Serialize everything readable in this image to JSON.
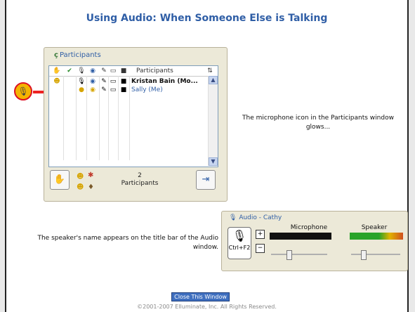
{
  "page_title": "Using Audio: When Someone Else is Talking",
  "participants_panel": {
    "title": "Participants",
    "header_label": "Participants",
    "rows": [
      {
        "name": "Kristan Bain (Mo..."
      },
      {
        "name": "Sally (Me)"
      }
    ],
    "count": "2",
    "count_label": "Participants"
  },
  "caption_1": "The microphone icon in the Participants window glows...",
  "audio_panel": {
    "title": "Audio - Cathy",
    "hotkey": "Ctrl+F2",
    "mic_label": "Microphone",
    "speaker_label": "Speaker",
    "meter_colors": {
      "mic": "#1a1a1a",
      "speaker_low": "#29a329",
      "speaker_high": "#e0b300"
    }
  },
  "caption_2": "The speaker's name appears on the title bar of the Audio window.",
  "close_button": "Close This Window",
  "copyright": "©2001-2007 Elluminate, Inc. All Rights Reserved.",
  "colors": {
    "accent": "#2f5ea6",
    "arrow": "#e22222"
  }
}
